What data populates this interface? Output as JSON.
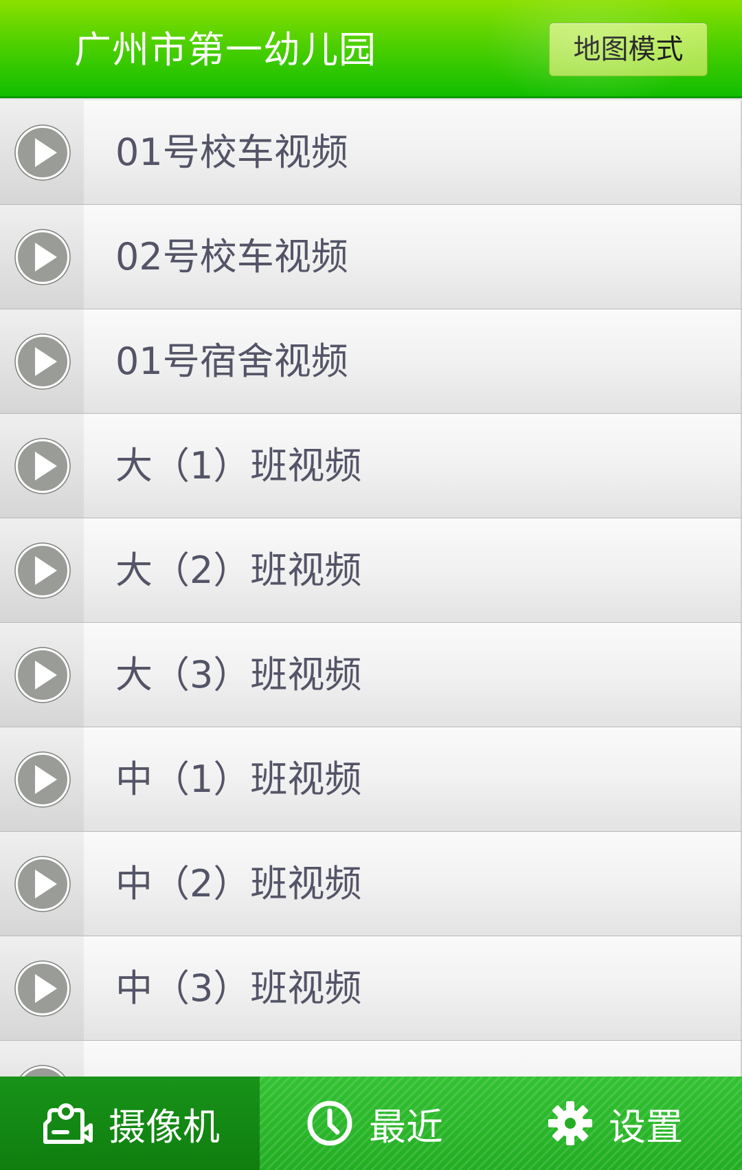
{
  "header": {
    "title": "广州市第一幼儿园",
    "map_mode_button": "地图模式"
  },
  "video_list": [
    {
      "label": "01号校车视频"
    },
    {
      "label": "02号校车视频"
    },
    {
      "label": "01号宿舍视频"
    },
    {
      "label": "大（1）班视频"
    },
    {
      "label": "大（2）班视频"
    },
    {
      "label": "大（3）班视频"
    },
    {
      "label": "中（1）班视频"
    },
    {
      "label": "中（2）班视频"
    },
    {
      "label": "中（3）班视频"
    },
    {
      "label": ""
    }
  ],
  "tabbar": {
    "tabs": [
      {
        "label": "摄像机",
        "icon": "camera-icon",
        "active": true
      },
      {
        "label": "最近",
        "icon": "clock-icon",
        "active": false
      },
      {
        "label": "设置",
        "icon": "gear-icon",
        "active": false
      }
    ]
  },
  "colors": {
    "header_green": "#11be00",
    "tabbar_green": "#22ad22",
    "active_tab": "#0f7e0f",
    "label_text": "#545468"
  }
}
